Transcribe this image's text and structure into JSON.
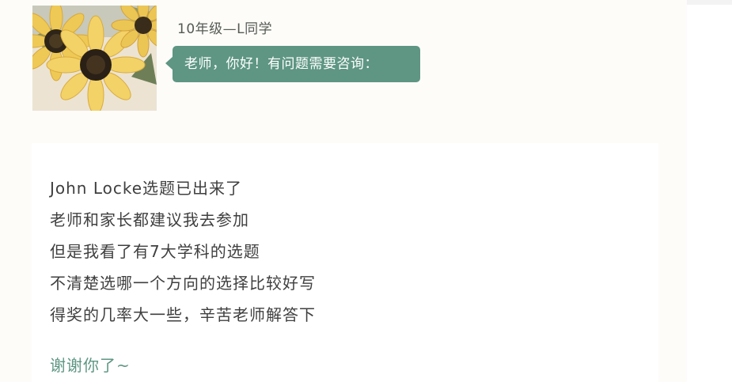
{
  "header": {
    "sender_name": "10年级—L同学",
    "bubble_text": "老师，你好！有问题需要咨询："
  },
  "message": {
    "lines": [
      "John Locke选题已出来了",
      "老师和家长都建议我去参加",
      "但是我看了有7大学科的选题",
      "不清楚选哪一个方向的选择比较好写",
      "得奖的几率大一些，辛苦老师解答下"
    ],
    "closing": "谢谢你了~"
  },
  "colors": {
    "accent": "#5e9683",
    "text": "#3f3f3f",
    "page_background": "#fdfcf9"
  },
  "icons": {
    "avatar": "sunflower-photo"
  }
}
